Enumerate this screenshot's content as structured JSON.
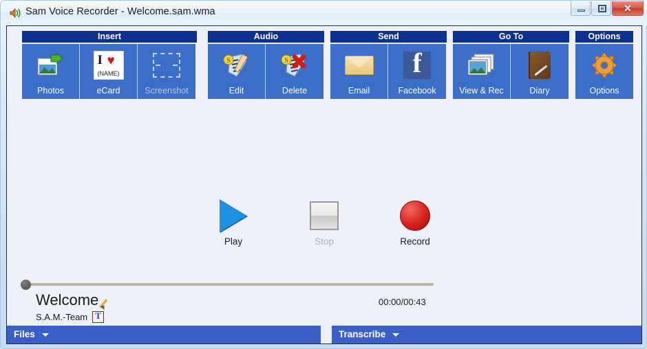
{
  "window": {
    "title": "Sam Voice Recorder - Welcome.sam.wma",
    "app_icon": "speaker-icon",
    "controls": {
      "minimize": "minimize-icon",
      "maximize": "maximize-icon",
      "close": "✕"
    },
    "accent_navy": "#0b3193",
    "accent_blue": "#3a6ec8",
    "bottom_blue": "#3a5fc8",
    "client_bg": "#eef1f8"
  },
  "ribbon": {
    "groups": [
      {
        "title": "Insert",
        "buttons": [
          {
            "label": "Photos",
            "icon": "photos-icon",
            "disabled": false
          },
          {
            "label": "eCard",
            "icon": "ecard-icon",
            "disabled": false
          },
          {
            "label": "Screenshot",
            "icon": "screenshot-icon",
            "disabled": true
          }
        ]
      },
      {
        "title": "Audio",
        "buttons": [
          {
            "label": "Edit",
            "icon": "audio-edit-icon",
            "disabled": false
          },
          {
            "label": "Delete",
            "icon": "audio-delete-icon",
            "disabled": false
          }
        ]
      },
      {
        "title": "Send",
        "buttons": [
          {
            "label": "Email",
            "icon": "email-icon",
            "disabled": false
          },
          {
            "label": "Facebook",
            "icon": "facebook-icon",
            "disabled": false
          }
        ]
      },
      {
        "title": "Go To",
        "buttons": [
          {
            "label": "View & Rec",
            "icon": "view-and-rec-icon",
            "disabled": false
          },
          {
            "label": "Diary",
            "icon": "diary-icon",
            "disabled": false
          }
        ]
      },
      {
        "title": "Options",
        "buttons": [
          {
            "label": "Options",
            "icon": "gear-icon",
            "disabled": false
          }
        ]
      }
    ],
    "ecard_icon_text": {
      "line1": "I",
      "heart": "♥",
      "line2": "(NAME)"
    }
  },
  "transport": {
    "play": {
      "label": "Play",
      "icon": "play-triangle-icon",
      "disabled": false
    },
    "stop": {
      "label": "Stop",
      "icon": "stop-square-icon",
      "disabled": true
    },
    "record": {
      "label": "Record",
      "icon": "record-circle-icon",
      "disabled": false
    }
  },
  "seek": {
    "position_percent": 0
  },
  "track": {
    "title": "Welcome",
    "title_edit_icon": "pencil-icon",
    "author": "S.A.M.-Team",
    "author_note_icon": "text-note-icon",
    "timecode": "00:00/00:43",
    "elapsed": "00:00",
    "duration": "00:43"
  },
  "bottom": {
    "files_label": "Files",
    "transcribe_label": "Transcribe"
  }
}
